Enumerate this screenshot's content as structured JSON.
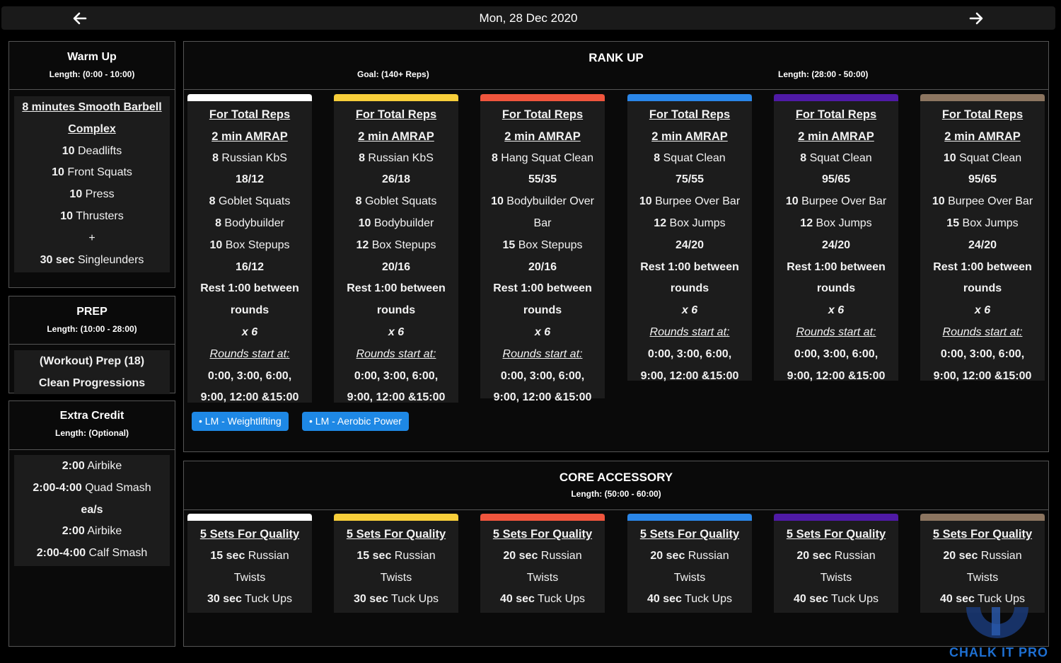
{
  "header": {
    "date": "Mon, 28 Dec 2020"
  },
  "colors": {
    "white": "#ffffff",
    "yellow": "#f7ce3a",
    "red": "#f0553d",
    "blue": "#2a86e8",
    "purple": "#4f1aa6",
    "brown": "#8c7560",
    "tag": "#1e88e5",
    "brand": "#1e6fd1"
  },
  "warmup": {
    "title": "Warm Up",
    "length": "Length: (0:00 - 10:00)",
    "lines": [
      {
        "t": "8 minutes Smooth Barbell",
        "s": "u"
      },
      {
        "t": "Complex",
        "s": "u"
      },
      {
        "t": "10 Deadlifts",
        "b": "10",
        "r": " Deadlifts"
      },
      {
        "t": "10 Front Squats",
        "b": "10",
        "r": " Front Squats"
      },
      {
        "t": "10 Press",
        "b": "10",
        "r": " Press"
      },
      {
        "t": "10 Thrusters",
        "b": "10",
        "r": " Thrusters"
      },
      {
        "t": "+"
      },
      {
        "t": "30 sec Singleunders",
        "b": "30 sec",
        "r": " Singleunders"
      }
    ]
  },
  "prep": {
    "title": "PREP",
    "length": "Length: (10:00 - 28:00)",
    "lines": [
      {
        "t": "(Workout)  Prep (18)",
        "s": "b"
      },
      {
        "t": "Clean Progressions",
        "s": "b"
      }
    ]
  },
  "extra": {
    "title": "Extra Credit",
    "length": "Length: (Optional)",
    "lines": [
      {
        "t": "2:00 Airbike",
        "b": "2:00",
        "r": " Airbike"
      },
      {
        "t": "2:00-4:00 Quad Smash",
        "b": "2:00-4:00",
        "r": " Quad Smash"
      },
      {
        "t": "ea/s",
        "s": "b"
      },
      {
        "t": "2:00 Airbike",
        "b": "2:00",
        "r": " Airbike"
      },
      {
        "t": "2:00-4:00 Calf Smash",
        "b": "2:00-4:00",
        "r": " Calf Smash"
      }
    ]
  },
  "rankup": {
    "title": "RANK UP",
    "goal": "Goal: (140+ Reps)",
    "length": "Length: (28:00 - 50:00)",
    "columns": [
      {
        "color": "white",
        "lines": [
          {
            "t": "For Total Reps",
            "s": "hdr"
          },
          {
            "t": "2 min AMRAP",
            "s": "hdr"
          },
          {
            "t": "8 Russian KbS",
            "b": "8",
            "r": " Russian KbS"
          },
          {
            "t": "18/12",
            "s": "bold"
          },
          {
            "t": "8 Goblet Squats",
            "b": "8",
            "r": " Goblet Squats"
          },
          {
            "t": "8 Bodybuilder",
            "b": "8",
            "r": " Bodybuilder"
          },
          {
            "t": "10 Box Stepups",
            "b": "10",
            "r": " Box Stepups"
          },
          {
            "t": "16/12",
            "s": "bold"
          },
          {
            "t": "Rest 1:00 between",
            "s": "bold"
          },
          {
            "t": "rounds",
            "s": "bold"
          },
          {
            "t": "x 6",
            "s": "it"
          },
          {
            "t": "Rounds start at:",
            "s": "itu"
          },
          {
            "t": "0:00, 3:00, 6:00,",
            "s": "bold"
          },
          {
            "t": "9:00, 12:00 &15:00",
            "s": "bold"
          }
        ]
      },
      {
        "color": "yellow",
        "lines": [
          {
            "t": "For Total Reps",
            "s": "hdr"
          },
          {
            "t": "2 min AMRAP",
            "s": "hdr"
          },
          {
            "t": "8 Russian KbS",
            "b": "8",
            "r": " Russian KbS"
          },
          {
            "t": "26/18",
            "s": "bold"
          },
          {
            "t": "8 Goblet Squats",
            "b": "8",
            "r": " Goblet Squats"
          },
          {
            "t": "10 Bodybuilder",
            "b": "10",
            "r": " Bodybuilder"
          },
          {
            "t": "12 Box Stepups",
            "b": "12",
            "r": " Box Stepups"
          },
          {
            "t": "20/16",
            "s": "bold"
          },
          {
            "t": "Rest 1:00 between",
            "s": "bold"
          },
          {
            "t": "rounds",
            "s": "bold"
          },
          {
            "t": "x 6",
            "s": "it"
          },
          {
            "t": "Rounds start at:",
            "s": "itu"
          },
          {
            "t": "0:00, 3:00, 6:00,",
            "s": "bold"
          },
          {
            "t": "9:00, 12:00 &15:00",
            "s": "bold"
          }
        ]
      },
      {
        "color": "red",
        "lines": [
          {
            "t": "For Total Reps",
            "s": "hdr"
          },
          {
            "t": "2 min AMRAP",
            "s": "hdr"
          },
          {
            "t": "8 Hang Squat Clean",
            "b": "8",
            "r": " Hang Squat Clean"
          },
          {
            "t": "55/35",
            "s": "bold"
          },
          {
            "t": "10 Bodybuilder Over",
            "b": "10",
            "r": " Bodybuilder Over"
          },
          {
            "t": "Bar"
          },
          {
            "t": "15 Box Stepups",
            "b": "15",
            "r": " Box Stepups"
          },
          {
            "t": "20/16",
            "s": "bold"
          },
          {
            "t": "Rest 1:00 between",
            "s": "bold"
          },
          {
            "t": "rounds",
            "s": "bold"
          },
          {
            "t": "x 6",
            "s": "it"
          },
          {
            "t": "Rounds start at:",
            "s": "itu"
          },
          {
            "t": "0:00, 3:00, 6:00,",
            "s": "bold"
          },
          {
            "t": "9:00, 12:00 &15:00",
            "s": "bold"
          }
        ]
      },
      {
        "color": "blue",
        "lines": [
          {
            "t": "For Total Reps",
            "s": "hdr"
          },
          {
            "t": "2 min AMRAP",
            "s": "hdr"
          },
          {
            "t": "8 Squat Clean",
            "b": "8",
            "r": " Squat Clean"
          },
          {
            "t": "75/55",
            "s": "bold"
          },
          {
            "t": "10 Burpee Over Bar",
            "b": "10",
            "r": " Burpee Over Bar"
          },
          {
            "t": "12 Box Jumps",
            "b": "12",
            "r": " Box Jumps"
          },
          {
            "t": "24/20",
            "s": "bold"
          },
          {
            "t": "Rest 1:00 between",
            "s": "bold"
          },
          {
            "t": "rounds",
            "s": "bold"
          },
          {
            "t": "x 6",
            "s": "it"
          },
          {
            "t": "Rounds start at:",
            "s": "itu"
          },
          {
            "t": "0:00, 3:00, 6:00,",
            "s": "bold"
          },
          {
            "t": "9:00, 12:00 &15:00",
            "s": "bold"
          }
        ]
      },
      {
        "color": "purple",
        "lines": [
          {
            "t": "For Total Reps",
            "s": "hdr"
          },
          {
            "t": "2 min AMRAP",
            "s": "hdr"
          },
          {
            "t": "8 Squat Clean",
            "b": "8",
            "r": " Squat Clean"
          },
          {
            "t": "95/65",
            "s": "bold"
          },
          {
            "t": "10 Burpee Over Bar",
            "b": "10",
            "r": " Burpee Over Bar"
          },
          {
            "t": "12 Box Jumps",
            "b": "12",
            "r": " Box Jumps"
          },
          {
            "t": "24/20",
            "s": "bold"
          },
          {
            "t": "Rest 1:00 between",
            "s": "bold"
          },
          {
            "t": "rounds",
            "s": "bold"
          },
          {
            "t": "x 6",
            "s": "it"
          },
          {
            "t": "Rounds start at:",
            "s": "itu"
          },
          {
            "t": "0:00, 3:00, 6:00,",
            "s": "bold"
          },
          {
            "t": "9:00, 12:00 &15:00",
            "s": "bold"
          }
        ]
      },
      {
        "color": "brown",
        "lines": [
          {
            "t": "For Total Reps",
            "s": "hdr"
          },
          {
            "t": "2 min AMRAP",
            "s": "hdr"
          },
          {
            "t": "10 Squat Clean",
            "b": "10",
            "r": " Squat Clean"
          },
          {
            "t": "95/65",
            "s": "bold"
          },
          {
            "t": "10 Burpee Over Bar",
            "b": "10",
            "r": " Burpee Over Bar"
          },
          {
            "t": "15 Box Jumps",
            "b": "15",
            "r": " Box Jumps"
          },
          {
            "t": "24/20",
            "s": "bold"
          },
          {
            "t": "Rest 1:00 between",
            "s": "bold"
          },
          {
            "t": "rounds",
            "s": "bold"
          },
          {
            "t": "x 6",
            "s": "it"
          },
          {
            "t": "Rounds start at:",
            "s": "itu"
          },
          {
            "t": "0:00, 3:00, 6:00,",
            "s": "bold"
          },
          {
            "t": "9:00, 12:00 &15:00",
            "s": "bold"
          }
        ]
      }
    ],
    "tags": [
      "• LM - Weightlifting",
      "• LM - Aerobic Power"
    ]
  },
  "core": {
    "title": "CORE ACCESSORY",
    "length": "Length: (50:00 - 60:00)",
    "columns": [
      {
        "color": "white",
        "lines": [
          {
            "t": "5 Sets For Quality",
            "s": "hdr"
          },
          {
            "t": "15 sec Russian",
            "b": "15 sec",
            "r": " Russian"
          },
          {
            "t": "Twists"
          },
          {
            "t": "30 sec Tuck Ups",
            "b": "30 sec",
            "r": " Tuck Ups"
          }
        ]
      },
      {
        "color": "yellow",
        "lines": [
          {
            "t": "5 Sets For Quality",
            "s": "hdr"
          },
          {
            "t": "15 sec Russian",
            "b": "15 sec",
            "r": " Russian"
          },
          {
            "t": "Twists"
          },
          {
            "t": "30 sec Tuck Ups",
            "b": "30 sec",
            "r": " Tuck Ups"
          }
        ]
      },
      {
        "color": "red",
        "lines": [
          {
            "t": "5 Sets For Quality",
            "s": "hdr"
          },
          {
            "t": "20 sec Russian",
            "b": "20 sec",
            "r": " Russian"
          },
          {
            "t": "Twists"
          },
          {
            "t": "40 sec Tuck Ups",
            "b": "40 sec",
            "r": " Tuck Ups"
          }
        ]
      },
      {
        "color": "blue",
        "lines": [
          {
            "t": "5 Sets For Quality",
            "s": "hdr"
          },
          {
            "t": "20 sec Russian",
            "b": "20 sec",
            "r": " Russian"
          },
          {
            "t": "Twists"
          },
          {
            "t": "40 sec Tuck Ups",
            "b": "40 sec",
            "r": " Tuck Ups"
          }
        ]
      },
      {
        "color": "purple",
        "lines": [
          {
            "t": "5 Sets For Quality",
            "s": "hdr"
          },
          {
            "t": "20 sec Russian",
            "b": "20 sec",
            "r": " Russian"
          },
          {
            "t": "Twists"
          },
          {
            "t": "40 sec Tuck Ups",
            "b": "40 sec",
            "r": " Tuck Ups"
          }
        ]
      },
      {
        "color": "brown",
        "lines": [
          {
            "t": "5 Sets For Quality",
            "s": "hdr"
          },
          {
            "t": "20 sec Russian",
            "b": "20 sec",
            "r": " Russian"
          },
          {
            "t": "Twists"
          },
          {
            "t": "40 sec Tuck Ups",
            "b": "40 sec",
            "r": " Tuck Ups"
          }
        ]
      }
    ]
  },
  "brand": {
    "name": "CHALK IT PRO",
    "icon": "chalk-it-pro-logo-icon"
  }
}
